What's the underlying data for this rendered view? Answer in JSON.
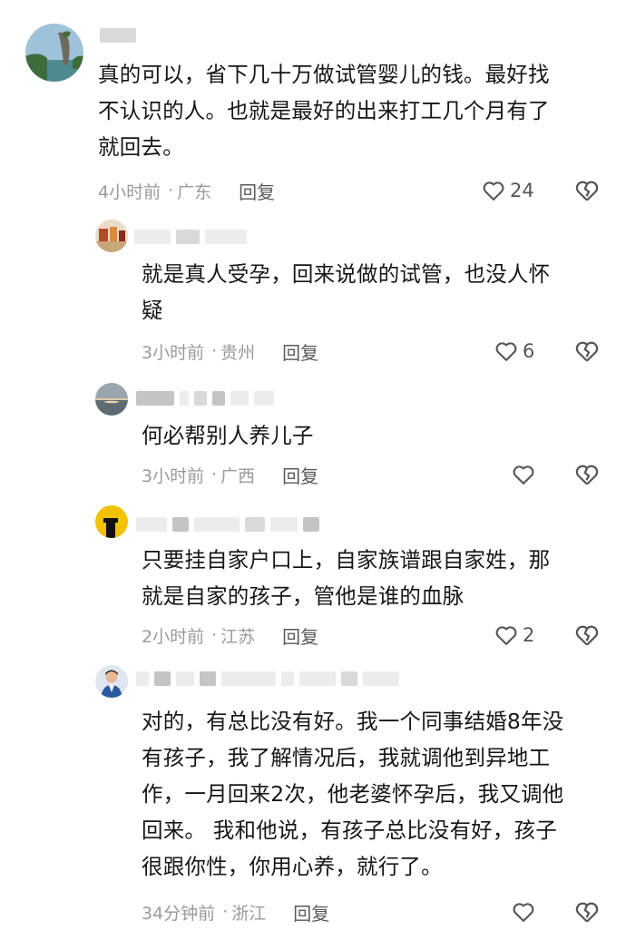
{
  "comments": [
    {
      "text": [
        "真的可以，省下几十万做试管婴儿的钱。最好找",
        "不认识的人。也就是最好的出来打工几个月有了",
        "就回去。"
      ],
      "time": "4小时前",
      "region": "广东",
      "reply_label": "回复",
      "likes": "24",
      "avatar_icon": "mountain-rock-avatar-icon"
    },
    {
      "text": [
        "就是真人受孕，回来说做的试管，也没人怀",
        "疑"
      ],
      "time": "3小时前",
      "region": "贵州",
      "reply_label": "回复",
      "likes": "6",
      "avatar_icon": "food-plate-avatar-icon"
    },
    {
      "text": [
        "何必帮别人养儿子"
      ],
      "time": "3小时前",
      "region": "广西",
      "reply_label": "回复",
      "likes": "",
      "avatar_icon": "sunset-lake-avatar-icon"
    },
    {
      "text": [
        "只要挂自家户口上，自家族谱跟自家姓，那",
        "就是自家的孩子，管他是谁的血脉"
      ],
      "time": "2小时前",
      "region": "江苏",
      "reply_label": "回复",
      "likes": "2",
      "avatar_icon": "yellow-black-avatar-icon"
    },
    {
      "text": [
        "对的，有总比没有好。我一个同事结婚8年没",
        "有孩子，我了解情况后，我就调他到异地工",
        "作，一月回来2次，他老婆怀孕后，我又调他",
        "回来。 我和他说，有孩子总比没有好，孩子",
        "很跟你性，你用心养，就行了。"
      ],
      "time": "34分钟前",
      "region": "浙江",
      "reply_label": "回复",
      "likes": "",
      "avatar_icon": "person-portrait-avatar-icon"
    }
  ],
  "separator": "·",
  "colors": {
    "text": "#161616",
    "meta": "#9a9a9a",
    "reply": "#5a5a5a",
    "icon": "#555555"
  }
}
